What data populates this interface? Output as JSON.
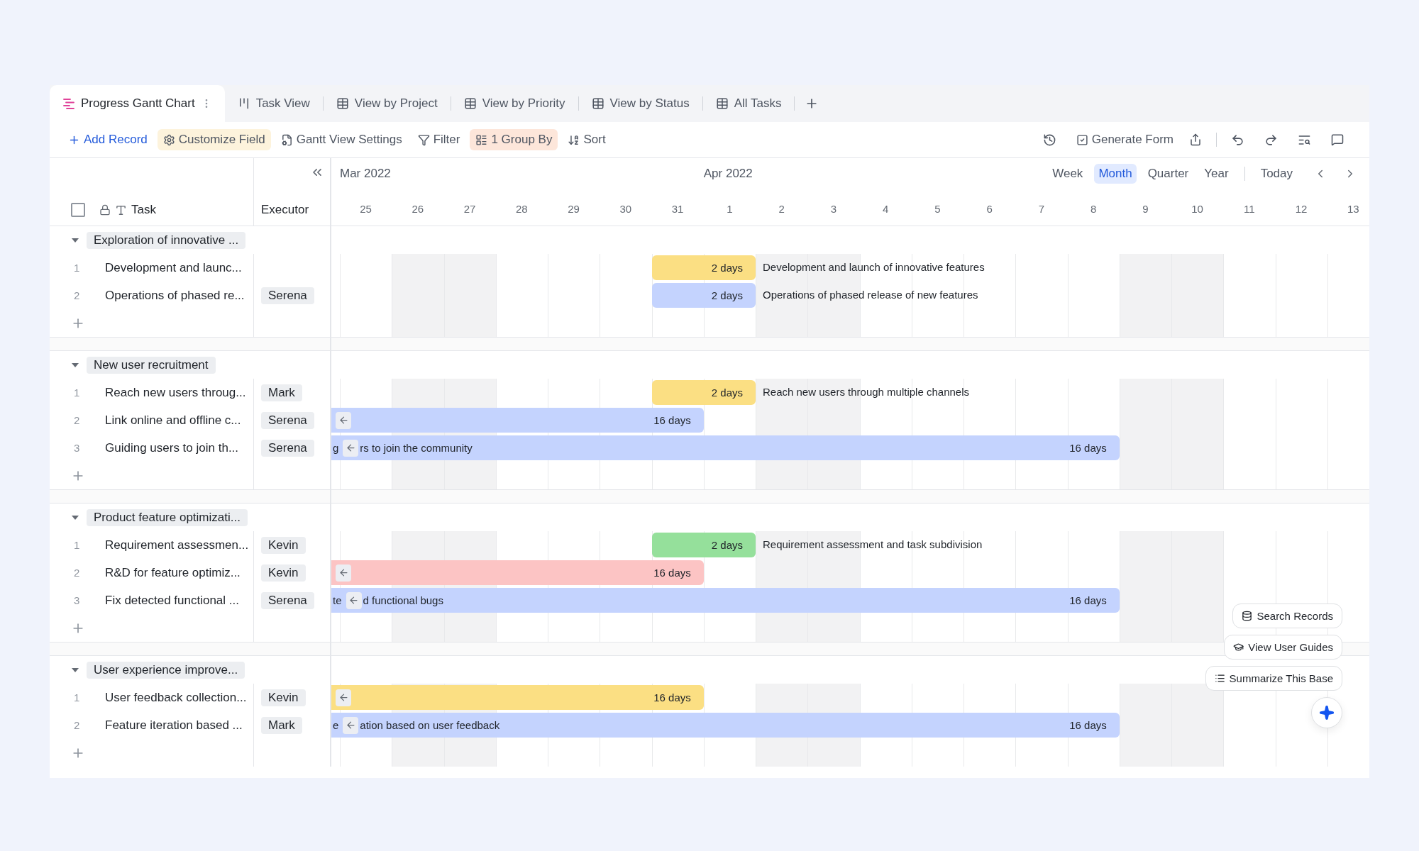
{
  "tabs": [
    {
      "label": "Progress Gantt Chart",
      "kind": "gantt",
      "selected": true
    },
    {
      "label": "Task View",
      "kind": "kanban",
      "selected": false
    },
    {
      "label": "View by Project",
      "kind": "grid",
      "selected": false
    },
    {
      "label": "View by Priority",
      "kind": "grid",
      "selected": false
    },
    {
      "label": "View by Status",
      "kind": "grid",
      "selected": false
    },
    {
      "label": "All Tasks",
      "kind": "grid",
      "selected": false
    }
  ],
  "toolbar": {
    "left": [
      {
        "label": "Add Record",
        "kind": "add",
        "active": false
      },
      {
        "label": "Customize Field",
        "kind": "field",
        "active": true,
        "color": "#fdf3dc"
      },
      {
        "label": "Gantt View Settings",
        "kind": "settings",
        "active": false
      },
      {
        "label": "Filter",
        "kind": "filter",
        "active": false
      },
      {
        "label": "1 Group By",
        "kind": "group",
        "active": true,
        "color": "#fde6da"
      },
      {
        "label": "Sort",
        "kind": "sort",
        "active": false
      }
    ],
    "generate_form": "Generate Form"
  },
  "table": {
    "select_all_checked": false,
    "columns": [
      "Task",
      "Executor"
    ]
  },
  "timeline": {
    "scales": [
      {
        "label": "Week",
        "selected": false
      },
      {
        "label": "Month",
        "selected": true
      },
      {
        "label": "Quarter",
        "selected": false
      },
      {
        "label": "Year",
        "selected": false
      }
    ],
    "today": "Today",
    "days": [
      {
        "label": "25",
        "weekend": false,
        "month": "Mar 2022"
      },
      {
        "label": "26",
        "weekend": true
      },
      {
        "label": "27",
        "weekend": true
      },
      {
        "label": "28",
        "weekend": false
      },
      {
        "label": "29",
        "weekend": false
      },
      {
        "label": "30",
        "weekend": false
      },
      {
        "label": "31",
        "weekend": false
      },
      {
        "label": "1",
        "weekend": false,
        "month": "Apr 2022"
      },
      {
        "label": "2",
        "weekend": true
      },
      {
        "label": "3",
        "weekend": true
      },
      {
        "label": "4",
        "weekend": false
      },
      {
        "label": "5",
        "weekend": false
      },
      {
        "label": "6",
        "weekend": false
      },
      {
        "label": "7",
        "weekend": false
      },
      {
        "label": "8",
        "weekend": false
      },
      {
        "label": "9",
        "weekend": true
      },
      {
        "label": "10",
        "weekend": true
      },
      {
        "label": "11",
        "weekend": false
      },
      {
        "label": "12",
        "weekend": false
      },
      {
        "label": "13",
        "weekend": false
      }
    ]
  },
  "groups": [
    {
      "title": "Exploration of innovative ...",
      "expanded": true,
      "rows": [
        {
          "number": "1",
          "task": "Development and launc...",
          "bar": {
            "kind": "short",
            "color": "#fbdf83",
            "duration": "2 days",
            "note": "Development and launch of innovative features"
          }
        },
        {
          "number": "2",
          "task": "Operations of phased re...",
          "executor": "Serena",
          "bar": {
            "kind": "short",
            "color": "#c4d3fe",
            "duration": "2 days",
            "note": "Operations of phased release of new features"
          }
        }
      ]
    },
    {
      "title": "New user recruitment",
      "expanded": true,
      "rows": [
        {
          "number": "1",
          "task": "Reach new users throug...",
          "executor": "Mark",
          "bar": {
            "kind": "short",
            "color": "#fbdf83",
            "duration": "2 days",
            "note": "Reach new users through multiple channels"
          }
        },
        {
          "number": "2",
          "task": "Link online and offline c...",
          "executor": "Serena",
          "bar": {
            "kind": "partial",
            "color": "#c4d3fe",
            "duration": "16 days",
            "jump_back": true
          }
        },
        {
          "number": "3",
          "task": "Guiding users to join th...",
          "executor": "Serena",
          "bar": {
            "kind": "long",
            "color": "#c4d3fe",
            "duration": "16 days",
            "jump_back": true,
            "inner_before": "g",
            "inner_after": "rs to join the community"
          }
        }
      ]
    },
    {
      "title": "Product feature optimizati...",
      "expanded": true,
      "rows": [
        {
          "number": "1",
          "task": "Requirement assessmen...",
          "executor": "Kevin",
          "bar": {
            "kind": "short",
            "color": "#95e09b",
            "duration": "2 days",
            "note": "Requirement assessment and task subdivision"
          }
        },
        {
          "number": "2",
          "task": "R&D for feature optimiz...",
          "executor": "Kevin",
          "bar": {
            "kind": "partial",
            "color": "#fcc4c4",
            "duration": "16 days",
            "jump_back": true
          }
        },
        {
          "number": "3",
          "task": "Fix detected functional ...",
          "executor": "Serena",
          "bar": {
            "kind": "long",
            "color": "#c4d3fe",
            "duration": "16 days",
            "jump_back": true,
            "inner_before": "te",
            "inner_after": "d functional bugs"
          }
        }
      ]
    },
    {
      "title": "User experience improve...",
      "expanded": true,
      "rows": [
        {
          "number": "1",
          "task": "User feedback collection...",
          "executor": "Kevin",
          "bar": {
            "kind": "partial",
            "color": "#fbdf83",
            "duration": "16 days",
            "jump_back": true
          }
        },
        {
          "number": "2",
          "task": "Feature iteration based ...",
          "executor": "Mark",
          "bar": {
            "kind": "long",
            "color": "#c4d3fe",
            "duration": "16 days",
            "jump_back": true,
            "inner_before": "e",
            "inner_after": "ation based on user feedback"
          }
        }
      ]
    }
  ],
  "assistant": [
    {
      "label": "Search Records",
      "kind": "search"
    },
    {
      "label": "View User Guides",
      "kind": "guide"
    },
    {
      "label": "Summarize This Base",
      "kind": "summary"
    }
  ]
}
